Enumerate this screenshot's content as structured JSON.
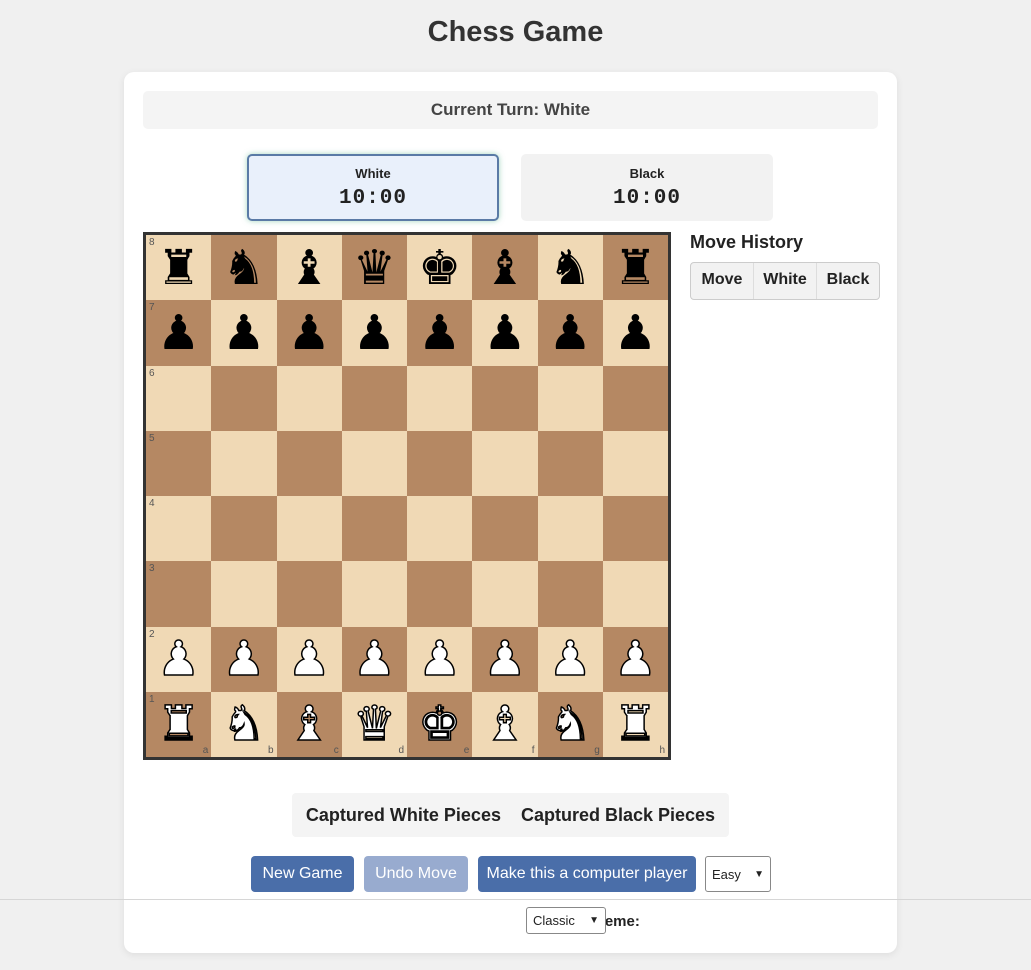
{
  "page": {
    "title": "Chess Game"
  },
  "turn": {
    "text": "Current Turn: White"
  },
  "timers": {
    "white": {
      "label": "White",
      "time": "10:00",
      "active": true
    },
    "black": {
      "label": "Black",
      "time": "10:00",
      "active": false
    }
  },
  "board": {
    "files": [
      "a",
      "b",
      "c",
      "d",
      "e",
      "f",
      "g",
      "h"
    ],
    "ranks": [
      "8",
      "7",
      "6",
      "5",
      "4",
      "3",
      "2",
      "1"
    ],
    "position": [
      [
        "br",
        "bn",
        "bb",
        "bq",
        "bk",
        "bb",
        "bn",
        "br"
      ],
      [
        "bp",
        "bp",
        "bp",
        "bp",
        "bp",
        "bp",
        "bp",
        "bp"
      ],
      [
        "",
        "",
        "",
        "",
        "",
        "",
        "",
        ""
      ],
      [
        "",
        "",
        "",
        "",
        "",
        "",
        "",
        ""
      ],
      [
        "",
        "",
        "",
        "",
        "",
        "",
        "",
        ""
      ],
      [
        "",
        "",
        "",
        "",
        "",
        "",
        "",
        ""
      ],
      [
        "wp",
        "wp",
        "wp",
        "wp",
        "wp",
        "wp",
        "wp",
        "wp"
      ],
      [
        "wr",
        "wn",
        "wb",
        "wq",
        "wk",
        "wb",
        "wn",
        "wr"
      ]
    ],
    "light_color": "#f0d9b5",
    "dark_color": "#b58863"
  },
  "history": {
    "title": "Move History",
    "columns": [
      "Move",
      "White",
      "Black"
    ]
  },
  "captured": {
    "white_label": "Captured White Pieces",
    "black_label": "Captured Black Pieces"
  },
  "controls": {
    "new_game": "New Game",
    "undo": "Undo Move",
    "computer": "Make this a computer player",
    "difficulty": "Easy",
    "theme_label": "Board Theme:",
    "theme": "Classic"
  },
  "colors": {
    "accent": "#4a6ea9",
    "accent_disabled": "#98abcf"
  }
}
